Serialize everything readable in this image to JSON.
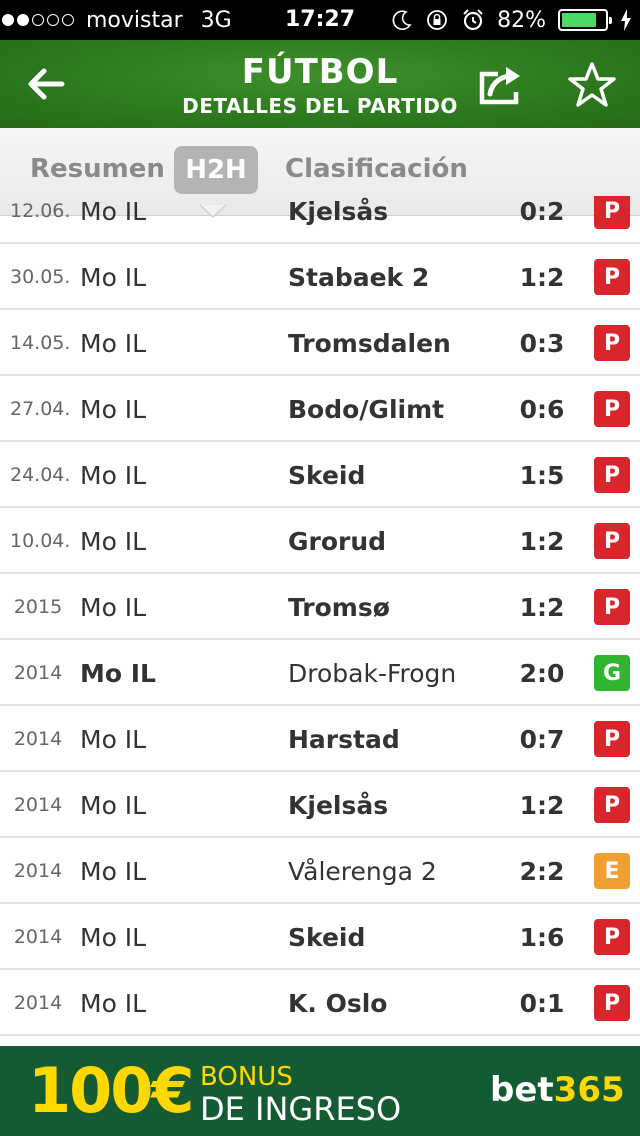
{
  "status_bar": {
    "carrier": "movistar",
    "network": "3G",
    "time": "17:27",
    "battery": "82%",
    "battery_level": 0.82,
    "signal_bars_filled": 2,
    "signal_bars_total": 5
  },
  "header": {
    "title": "FÚTBOL",
    "subtitle": "DETALLES DEL PARTIDO"
  },
  "tabs": [
    {
      "label": "Resumen",
      "active": false
    },
    {
      "label": "H2H",
      "active": true
    },
    {
      "label": "Clasificación",
      "active": false
    }
  ],
  "colors": {
    "header_green": "#2e7a1f",
    "loss": "#d9262c",
    "win": "#2fb52f",
    "draw": "#f0a030",
    "banner_bg": "#145a32",
    "banner_yellow": "#ffd800"
  },
  "matches": [
    {
      "date": "12.06.",
      "home": "Mo IL",
      "away": "Kjelsås",
      "score": "0:2",
      "result": "P",
      "winner": "away"
    },
    {
      "date": "30.05.",
      "home": "Mo IL",
      "away": "Stabaek 2",
      "score": "1:2",
      "result": "P",
      "winner": "away"
    },
    {
      "date": "14.05.",
      "home": "Mo IL",
      "away": "Tromsdalen",
      "score": "0:3",
      "result": "P",
      "winner": "away"
    },
    {
      "date": "27.04.",
      "home": "Mo IL",
      "away": "Bodo/Glimt",
      "score": "0:6",
      "result": "P",
      "winner": "away"
    },
    {
      "date": "24.04.",
      "home": "Mo IL",
      "away": "Skeid",
      "score": "1:5",
      "result": "P",
      "winner": "away"
    },
    {
      "date": "10.04.",
      "home": "Mo IL",
      "away": "Grorud",
      "score": "1:2",
      "result": "P",
      "winner": "away"
    },
    {
      "date": "2015",
      "home": "Mo IL",
      "away": "Tromsø",
      "score": "1:2",
      "result": "P",
      "winner": "away"
    },
    {
      "date": "2014",
      "home": "Mo IL",
      "away": "Drobak-Frogn",
      "score": "2:0",
      "result": "G",
      "winner": "home"
    },
    {
      "date": "2014",
      "home": "Mo IL",
      "away": "Harstad",
      "score": "0:7",
      "result": "P",
      "winner": "away"
    },
    {
      "date": "2014",
      "home": "Mo IL",
      "away": "Kjelsås",
      "score": "1:2",
      "result": "P",
      "winner": "away"
    },
    {
      "date": "2014",
      "home": "Mo IL",
      "away": "Vålerenga 2",
      "score": "2:2",
      "result": "E",
      "winner": "none"
    },
    {
      "date": "2014",
      "home": "Mo IL",
      "away": "Skeid",
      "score": "1:6",
      "result": "P",
      "winner": "away"
    },
    {
      "date": "2014",
      "home": "Mo IL",
      "away": "K. Oslo",
      "score": "0:1",
      "result": "P",
      "winner": "away"
    }
  ],
  "banner": {
    "amount": "100€",
    "line1": "BONUS",
    "line2": "DE INGRESO",
    "brand_part1": "bet",
    "brand_part2": "365"
  }
}
